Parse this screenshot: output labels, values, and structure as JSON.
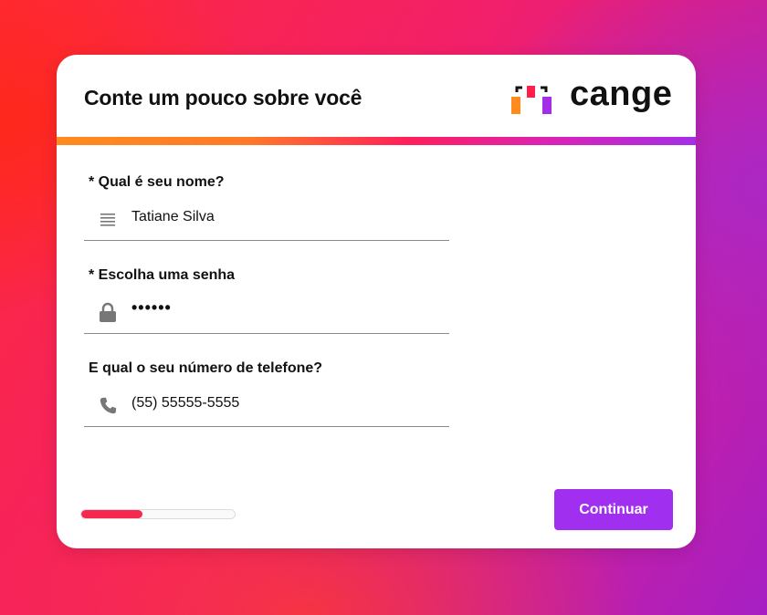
{
  "header": {
    "title": "Conte um pouco sobre você",
    "logo_text": "cange"
  },
  "form": {
    "fields": [
      {
        "label": "* Qual é seu nome?",
        "value": "Tatiane Silva",
        "icon": "text-lines-icon"
      },
      {
        "label": "* Escolha uma senha",
        "value": "••••••",
        "icon": "lock-icon"
      },
      {
        "label": "E qual o seu número de telefone?",
        "value": "(55) 55555-5555",
        "icon": "phone-icon"
      }
    ]
  },
  "footer": {
    "progress_fraction": 0.4,
    "continue_label": "Continuar"
  },
  "colors": {
    "accent_button": "#a12ff0",
    "progress_fill": "#f5284f",
    "logo_orange": "#ff8a1e",
    "logo_red": "#ff1f4a",
    "logo_purple": "#a42ee6"
  }
}
